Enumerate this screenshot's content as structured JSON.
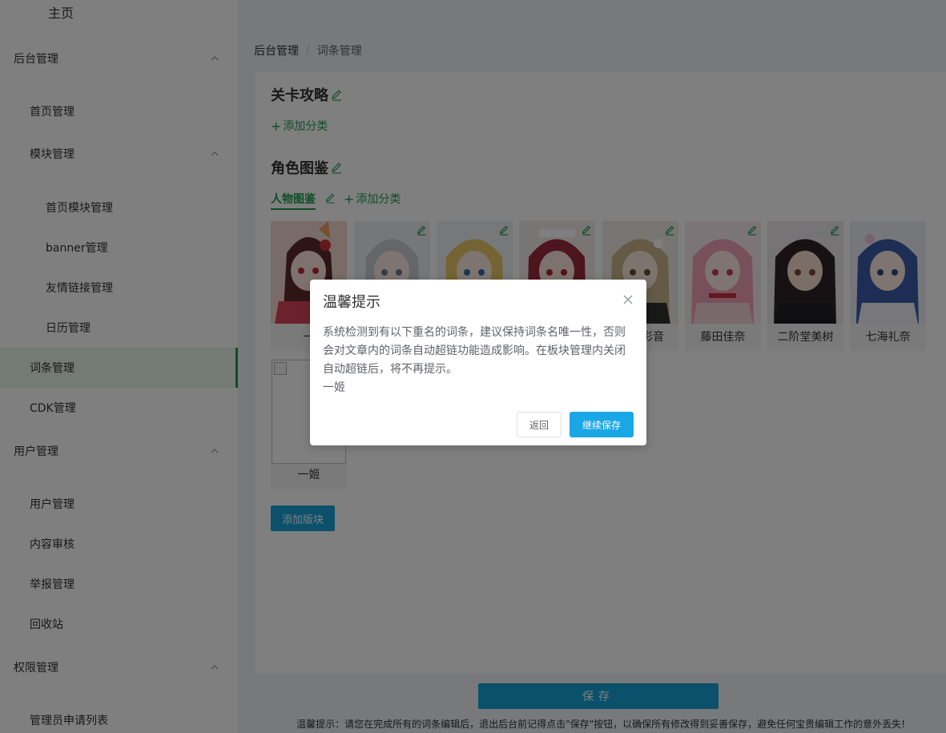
{
  "sidebar": {
    "home": "主页",
    "items": [
      {
        "label": "后台管理",
        "level": 0,
        "expanded": true
      },
      {
        "label": "首页管理",
        "level": 1
      },
      {
        "label": "模块管理",
        "level": 1,
        "expanded": true
      },
      {
        "label": "首页模块管理",
        "level": 2
      },
      {
        "label": "banner管理",
        "level": 2
      },
      {
        "label": "友情链接管理",
        "level": 2
      },
      {
        "label": "日历管理",
        "level": 2
      },
      {
        "label": "词条管理",
        "level": 1,
        "active": true
      },
      {
        "label": "CDK管理",
        "level": 1
      },
      {
        "label": "用户管理",
        "level": 0,
        "expanded": true
      },
      {
        "label": "用户管理",
        "level": 1
      },
      {
        "label": "内容审核",
        "level": 1
      },
      {
        "label": "举报管理",
        "level": 1
      },
      {
        "label": "回收站",
        "level": 1
      },
      {
        "label": "权限管理",
        "level": 0,
        "expanded": true
      },
      {
        "label": "管理员申请列表",
        "level": 1
      }
    ]
  },
  "breadcrumb": {
    "root": "后台管理",
    "separator": "/",
    "current": "词条管理"
  },
  "sections": {
    "strategy": {
      "title": "关卡攻略",
      "add_category": "添加分类"
    },
    "characters": {
      "title": "角色图鉴",
      "active_tab": "人物图鉴",
      "add_category": "添加分类",
      "cards": [
        {
          "name": "一"
        },
        {
          "name": ""
        },
        {
          "name": ""
        },
        {
          "name": ""
        },
        {
          "name": "彩音"
        },
        {
          "name": "藤田佳奈"
        },
        {
          "name": "二阶堂美树"
        },
        {
          "name": "七海礼奈"
        },
        {
          "name": "一姬"
        }
      ]
    }
  },
  "add_block_button": "添加版块",
  "save": {
    "button": "保存",
    "tip": "温馨提示：请您在完成所有的词条编辑后，退出后台前记得点击\"保存\"按钮，以确保所有修改得到妥善保存，避免任何宝贵编辑工作的意外丢失!"
  },
  "dialog": {
    "title": "温馨提示",
    "message": "系统检测到有以下重名的词条，建议保持词条名唯一性，否则会对文章内的词条自动超链功能造成影响。在板块管理内关闭自动超链后，将不再提示。",
    "duplicate_name": "一姬",
    "back_button": "返回",
    "continue_button": "继续保存"
  },
  "colors": {
    "accent_green": "#1f9a4c",
    "primary_blue": "#17a2d6",
    "overlay": "rgba(0,0,0,0.5)"
  }
}
